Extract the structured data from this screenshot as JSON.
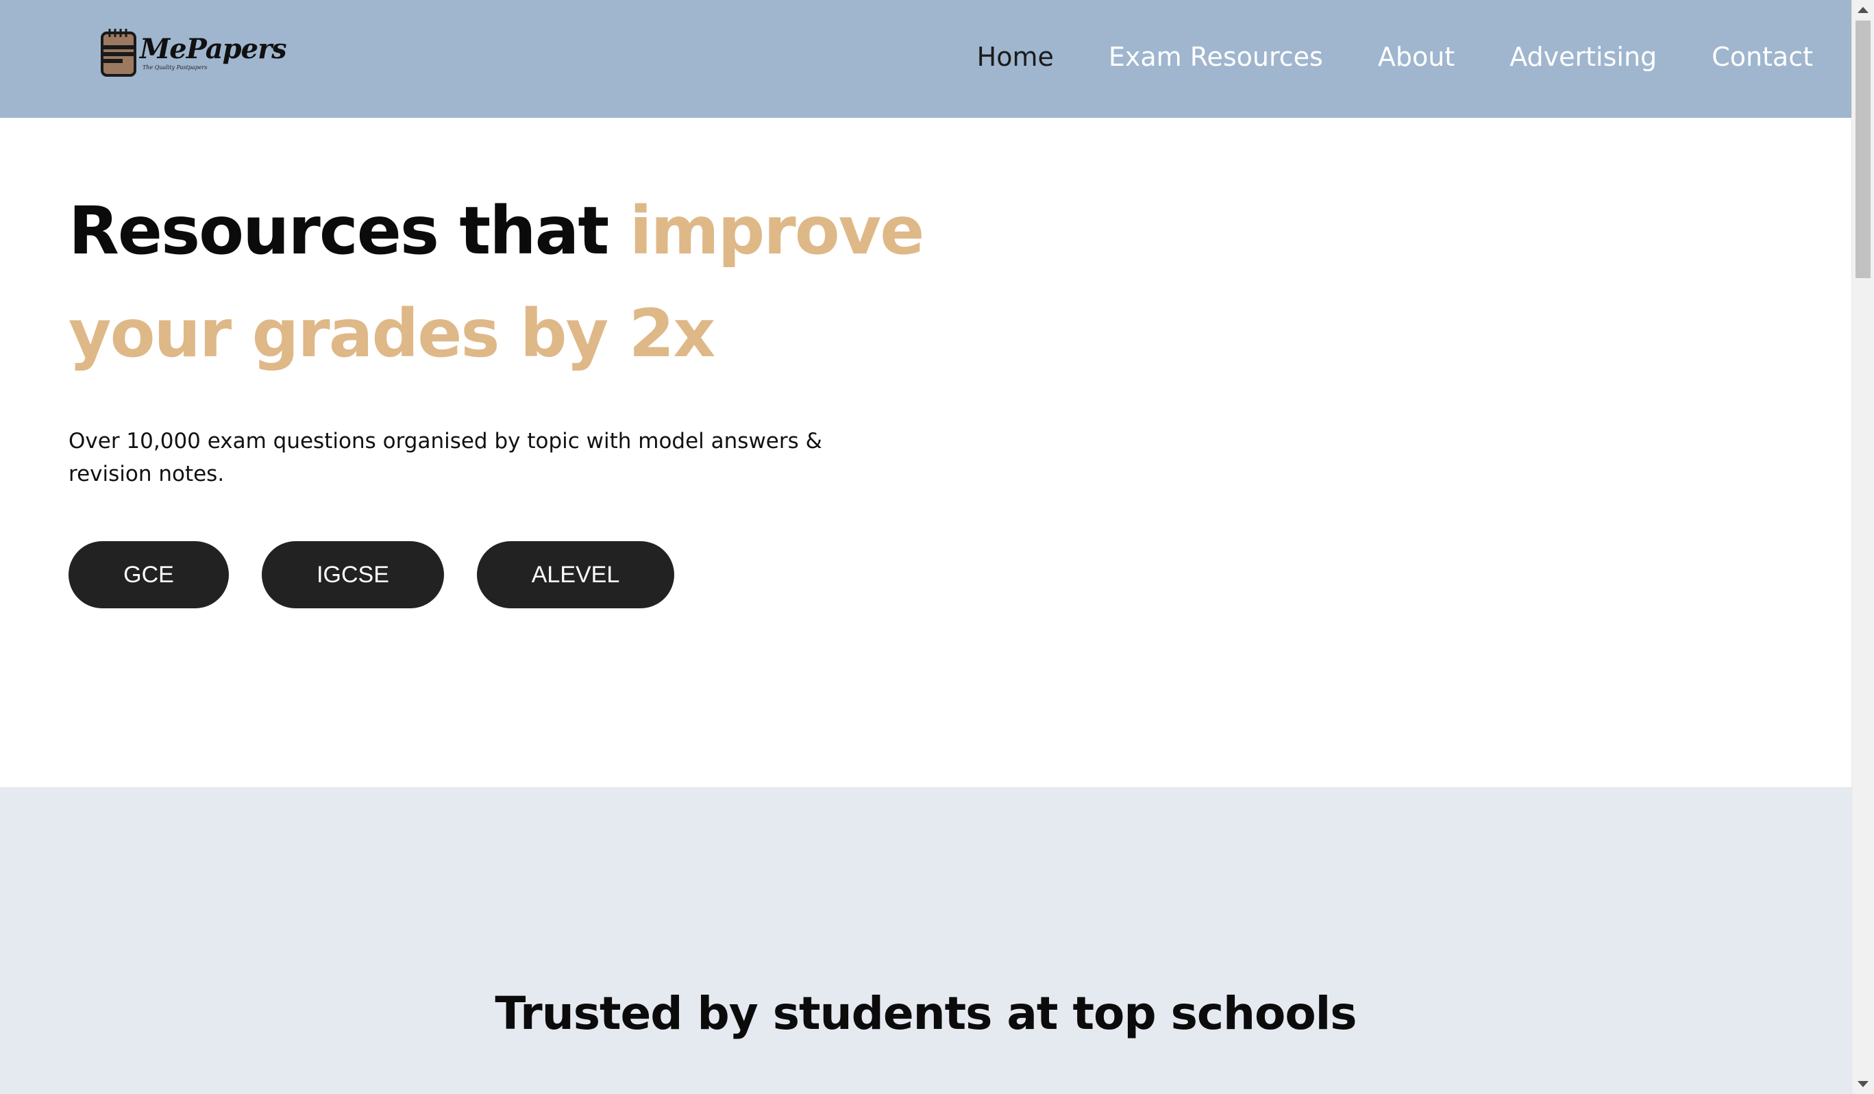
{
  "header": {
    "logo": {
      "word": "MePapers",
      "tagline": "The Quality Pastpapers"
    },
    "nav": [
      {
        "label": "Home",
        "active": true
      },
      {
        "label": "Exam Resources",
        "active": false
      },
      {
        "label": "About",
        "active": false
      },
      {
        "label": "Advertising",
        "active": false
      },
      {
        "label": "Contact",
        "active": false
      }
    ]
  },
  "hero": {
    "title_part1": "Resources that ",
    "title_part2": "improve your grades by 2x",
    "subtitle": "Over 10,000 exam questions organised by topic with model answers & revision notes.",
    "buttons": [
      {
        "label": "GCE"
      },
      {
        "label": "IGCSE"
      },
      {
        "label": "ALEVEL"
      }
    ]
  },
  "trusted": {
    "title": "Trusted by students at top schools"
  },
  "colors": {
    "header_bg": "#9fb6ce",
    "accent": "#dfb888",
    "button_bg": "#222222",
    "section_bg": "#e5e9f0"
  },
  "icons": {
    "logo": "notepad-icon"
  }
}
